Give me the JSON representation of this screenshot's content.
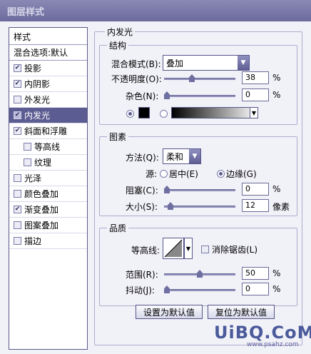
{
  "window": {
    "title": "图层样式"
  },
  "left": {
    "header": "样式",
    "items": [
      {
        "label": "混合选项:默认",
        "checkbox": false,
        "sub": false,
        "checked": false,
        "selected": false
      },
      {
        "label": "投影",
        "checkbox": true,
        "sub": false,
        "checked": true,
        "selected": false
      },
      {
        "label": "内阴影",
        "checkbox": true,
        "sub": false,
        "checked": true,
        "selected": false
      },
      {
        "label": "外发光",
        "checkbox": true,
        "sub": false,
        "checked": false,
        "selected": false
      },
      {
        "label": "内发光",
        "checkbox": true,
        "sub": false,
        "checked": true,
        "selected": true
      },
      {
        "label": "斜面和浮雕",
        "checkbox": true,
        "sub": false,
        "checked": true,
        "selected": false
      },
      {
        "label": "等高线",
        "checkbox": true,
        "sub": true,
        "checked": false,
        "selected": false
      },
      {
        "label": "纹理",
        "checkbox": true,
        "sub": true,
        "checked": false,
        "selected": false
      },
      {
        "label": "光泽",
        "checkbox": true,
        "sub": false,
        "checked": false,
        "selected": false
      },
      {
        "label": "颜色叠加",
        "checkbox": true,
        "sub": false,
        "checked": false,
        "selected": false
      },
      {
        "label": "渐变叠加",
        "checkbox": true,
        "sub": false,
        "checked": true,
        "selected": false
      },
      {
        "label": "图案叠加",
        "checkbox": true,
        "sub": false,
        "checked": false,
        "selected": false
      },
      {
        "label": "描边",
        "checkbox": true,
        "sub": false,
        "checked": false,
        "selected": false
      }
    ]
  },
  "panel": {
    "title": "内发光",
    "structure": {
      "title": "结构",
      "blend_mode_label": "混合模式(B):",
      "blend_mode_value": "叠加",
      "opacity_label": "不透明度(O):",
      "opacity_value": "38",
      "opacity_level": 0.38,
      "noise_label": "杂色(N):",
      "noise_value": "0",
      "noise_level": 0,
      "percent": "%",
      "color_swatch": "#000000"
    },
    "elements": {
      "title": "图素",
      "method_label": "方法(Q):",
      "method_value": "柔和",
      "source_label": "源:",
      "source_center": "居中(E)",
      "source_edge": "边缘(G)",
      "source_selected": "edge",
      "choke_label": "阻塞(C):",
      "choke_value": "0",
      "choke_level": 0,
      "size_label": "大小(S):",
      "size_value": "12",
      "size_unit": "像素",
      "size_level": 0.05
    },
    "quality": {
      "title": "品质",
      "contour_label": "等高线:",
      "antialias_label": "消除锯齿(L)",
      "antialias_checked": false,
      "range_label": "范围(R):",
      "range_value": "50",
      "range_level": 0.5,
      "jitter_label": "抖动(J):",
      "jitter_value": "0",
      "jitter_level": 0
    },
    "buttons": {
      "make_default": "设置为默认值",
      "reset_default": "复位为默认值"
    }
  },
  "watermark": {
    "main": "UiBQ.CoM",
    "sub": "www.psahz.com"
  },
  "colors": {
    "accent": "#5b5c92",
    "border": "#5c5a86",
    "background": "#f1f1f8"
  }
}
